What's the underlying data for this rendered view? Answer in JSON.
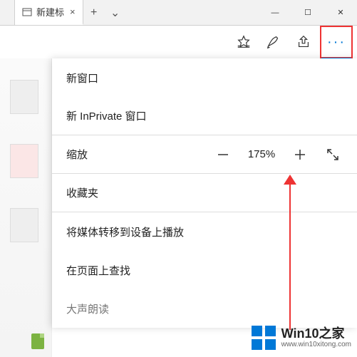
{
  "tabs": {
    "first_label": "  ",
    "active_label": "新建标",
    "close_glyph": "×",
    "newtab_glyph": "+",
    "tabactions_glyph": "⌄"
  },
  "window_controls": {
    "minimize": "—",
    "maximize": "☐",
    "close": "✕"
  },
  "toolbar": {
    "favorites_icon": "favorites-star-icon",
    "notes_icon": "pen-icon",
    "share_icon": "share-icon",
    "more_icon": "more-icon",
    "more_glyph": "···"
  },
  "menu": {
    "new_window": "新窗口",
    "new_inprivate": "新 InPrivate 窗口",
    "zoom_label": "缩放",
    "zoom_value": "175%",
    "favorites": "收藏夹",
    "cast": "将媒体转移到设备上播放",
    "find": "在页面上查找",
    "read_aloud": "大声朗读"
  },
  "watermark": {
    "title": "Win10之家",
    "url": "www.win10xitong.com"
  },
  "colors": {
    "accent": "#0078d7",
    "highlight_border": "#e33"
  }
}
